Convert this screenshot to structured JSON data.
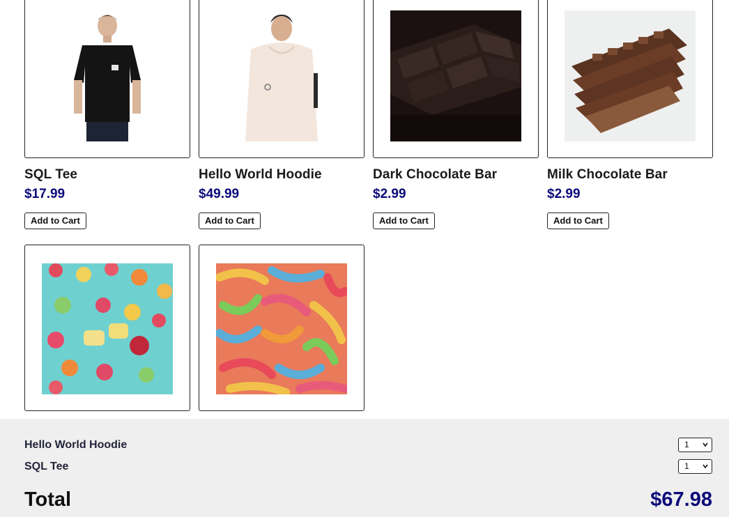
{
  "products": [
    {
      "name": "SQL Tee",
      "price": "$17.99",
      "button": "Add to Cart",
      "image": "black-tshirt-photo"
    },
    {
      "name": "Hello World Hoodie",
      "price": "$49.99",
      "button": "Add to Cart",
      "image": "cream-hoodie-photo"
    },
    {
      "name": "Dark Chocolate Bar",
      "price": "$2.99",
      "button": "Add to Cart",
      "image": "dark-chocolate-photo"
    },
    {
      "name": "Milk Chocolate Bar",
      "price": "$2.99",
      "button": "Add to Cart",
      "image": "milk-chocolate-photo"
    },
    {
      "image": "hard-candies-photo"
    },
    {
      "image": "gummy-worms-photo"
    }
  ],
  "cart": {
    "items": [
      {
        "name": "Hello World Hoodie",
        "quantity": "1"
      },
      {
        "name": "SQL Tee",
        "quantity": "1"
      }
    ],
    "total_label": "Total",
    "total_value": "$67.98"
  },
  "colors": {
    "price": "#0b0b7a",
    "cart_bg": "#efefef"
  }
}
